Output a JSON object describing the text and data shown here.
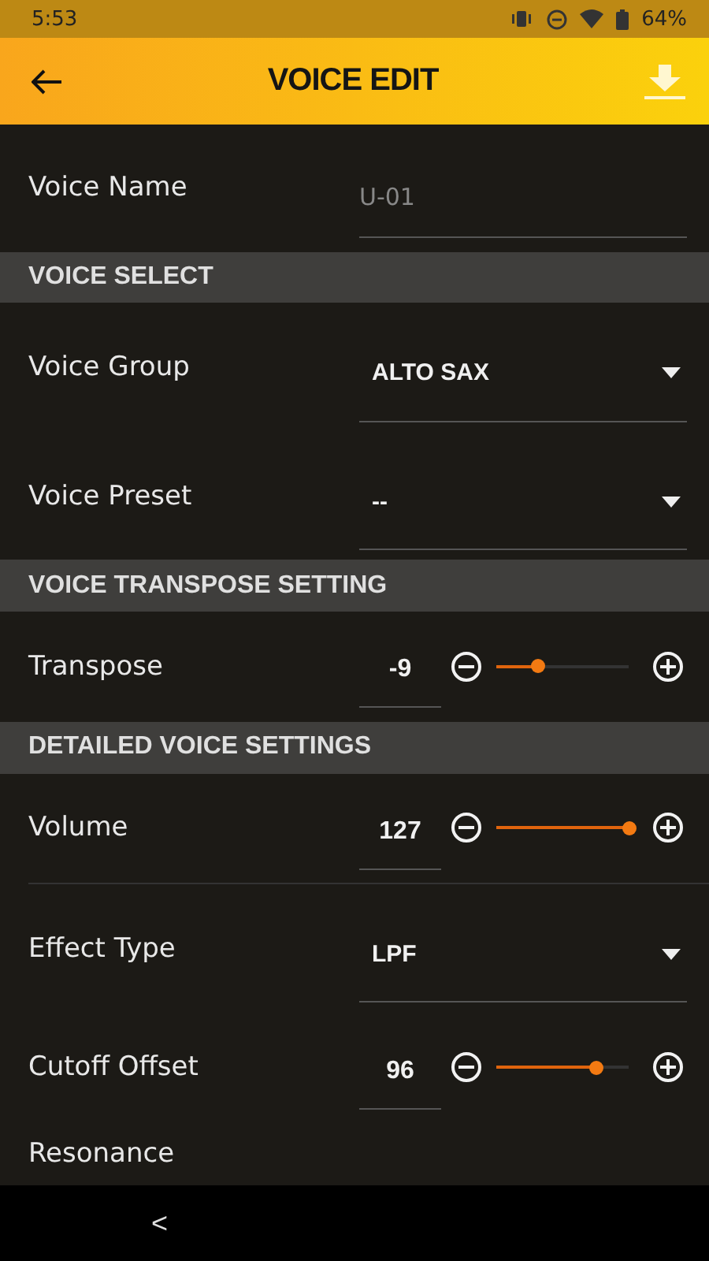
{
  "status_bar": {
    "time": "5:53",
    "battery": "64%"
  },
  "header": {
    "title": "VOICE EDIT"
  },
  "voice_name": {
    "label": "Voice Name",
    "placeholder": "U-01"
  },
  "sections": [
    {
      "title": "VOICE SELECT",
      "rows": [
        {
          "kind": "dropdown",
          "label": "Voice Group",
          "value": "ALTO SAX"
        },
        {
          "kind": "dropdown",
          "label": "Voice Preset",
          "value": "--"
        }
      ]
    },
    {
      "title": "VOICE TRANSPOSE SETTING",
      "rows": [
        {
          "kind": "slider",
          "label": "Transpose",
          "value": "-9",
          "level": 0.31
        }
      ]
    },
    {
      "title": "DETAILED VOICE SETTINGS",
      "rows": [
        {
          "kind": "slider",
          "label": "Volume",
          "value": "127",
          "level": 1.0
        },
        {
          "kind": "dropdown",
          "label": "Effect Type",
          "value": "LPF"
        },
        {
          "kind": "slider",
          "label": "Cutoff Offset",
          "value": "96",
          "level": 0.756
        },
        {
          "kind": "label",
          "label": "Resonance"
        }
      ]
    }
  ],
  "nav_bar": {
    "back": "<"
  }
}
